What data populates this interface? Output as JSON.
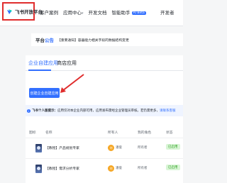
{
  "brand": {
    "name": "飞书开放平台"
  },
  "nav": {
    "items": [
      {
        "label": "客户案例"
      },
      {
        "label": "应用中心",
        "caret": "▾"
      },
      {
        "label": "开发文档"
      },
      {
        "label": "智能助手",
        "badge": "AI Beta"
      }
    ],
    "right_label": "开发者"
  },
  "announcement": {
    "title_prefix": "平台",
    "title_highlight": "公告",
    "text": "【重要通知】容器能力相关字段的数据结构变更"
  },
  "tabs": [
    {
      "label": "企业自建应用",
      "active": true
    },
    {
      "label": "商店应用",
      "active": false
    }
  ],
  "create_button": {
    "label": "创建企业自建应用"
  },
  "tip": {
    "icon": "i",
    "bold": "飞书个人版提示：",
    "text": "应用仅对本企业内部可用，应用发布需经企业管理员审核。若仍需更多，",
    "link": "请联系客服"
  },
  "table": {
    "headers": [
      "图标",
      "名称",
      "所有人",
      "我的角色",
      "状态"
    ],
    "rows": [
      {
        "icon": "app-avatar",
        "name": "【教程】产品规划专家",
        "owner_initial": "刘",
        "owner": "潘俊",
        "role": "所有者",
        "status": "已启用"
      },
      {
        "icon": "app-avatar",
        "name": "【教程】需求分析专家",
        "owner_initial": "刘",
        "owner": "潘俊",
        "role": "所有者",
        "status": "已启用"
      }
    ]
  },
  "colors": {
    "accent": "#3370ff",
    "highlight_border": "#e02d2d",
    "status_green": "#2ea121"
  }
}
